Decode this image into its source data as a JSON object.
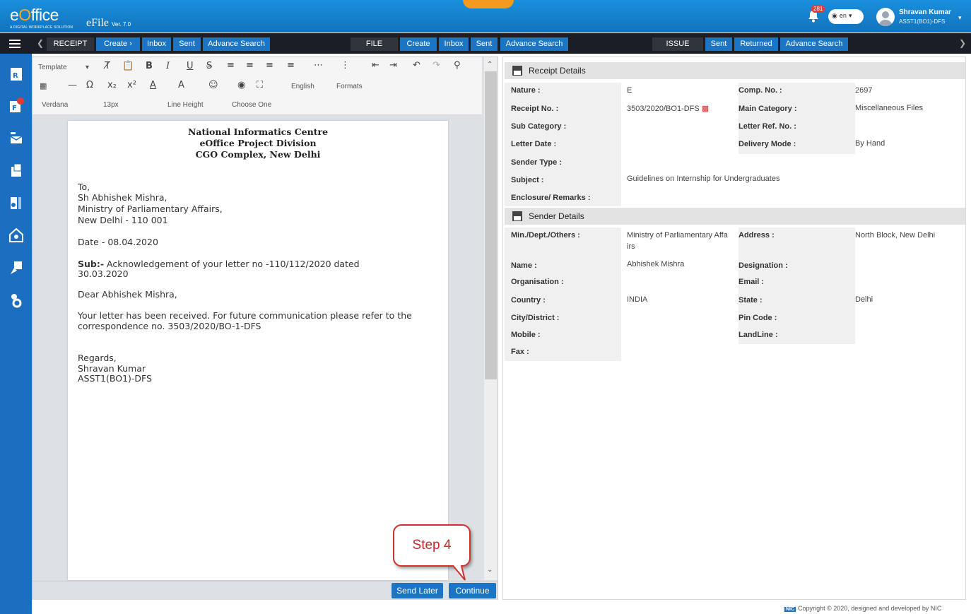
{
  "header": {
    "logo_e": "e",
    "logo_o": "O",
    "logo_rest": "ffice",
    "logo_tagline": "A DIGITAL WORKPLACE SOLUTION",
    "app_name": "eFile",
    "version": "Ver. 7.0",
    "notif_count": "281",
    "lang": "en",
    "user_name": "Shravan Kumar",
    "user_role": "ASST1(BO1)-DFS"
  },
  "nav": {
    "receipt": {
      "label": "RECEIPT",
      "create": "Create",
      "inbox": "Inbox",
      "sent": "Sent",
      "advance_search": "Advance Search"
    },
    "file": {
      "label": "FILE",
      "create": "Create",
      "inbox": "Inbox",
      "sent": "Sent",
      "advance_search": "Advance Search"
    },
    "issue": {
      "label": "ISSUE",
      "sent": "Sent",
      "returned": "Returned",
      "advance_search": "Advance Search"
    }
  },
  "toolbar": {
    "template": "Template",
    "language": "English",
    "formats": "Formats",
    "font": "Verdana",
    "size": "13px",
    "line_height": "Line Height",
    "choose_one": "Choose One"
  },
  "document": {
    "org1": "National Informatics Centre",
    "org2": "eOffice Project Division",
    "org3": "CGO Complex, New Delhi",
    "to": "To,",
    "addr1": "Sh Abhishek Mishra,",
    "addr2": "Ministry of Parliamentary Affairs,",
    "addr3": "New Delhi - 110 001",
    "date": "Date - 08.04.2020",
    "sub_label": "Sub:-",
    "sub_text": " Acknowledgement of your letter no -110/112/2020 dated",
    "sub_text2": "30.03.2020",
    "salutation": "Dear Abhishek Mishra,",
    "body1": "Your letter has been received. For future communication please refer to the",
    "body2": "correspondence no. 3503/2020/BO-1-DFS",
    "regards": "Regards,",
    "sign_name": "Shravan Kumar",
    "sign_role": "ASST1(BO1)-DFS"
  },
  "buttons": {
    "send_later": "Send Later",
    "continue": "Continue"
  },
  "callout": "Step 4",
  "receipt_details": {
    "title": "Receipt Details",
    "nature_label": "Nature :",
    "nature_value": "E",
    "comp_no_label": "Comp. No. :",
    "comp_no_value": "2697",
    "receipt_no_label": "Receipt No. :",
    "receipt_no_value": "3503/2020/BO1-DFS",
    "main_category_label": "Main Category :",
    "main_category_value": "Miscellaneous Files",
    "sub_category_label": "Sub Category :",
    "letter_ref_label": "Letter Ref. No. :",
    "letter_date_label": "Letter Date :",
    "delivery_mode_label": "Delivery Mode :",
    "delivery_mode_value": "By Hand",
    "sender_type_label": "Sender Type :",
    "subject_label": "Subject :",
    "subject_value": "Guidelines on Internship for Undergraduates",
    "enclosure_label": "Enclosure/ Remarks :"
  },
  "sender_details": {
    "title": "Sender Details",
    "ministry_label": "Min./Dept./Others :",
    "ministry_value1": "Ministry of Parliamentary Affa",
    "ministry_value2": "irs",
    "address_label": "Address :",
    "address_value": "North Block, New Delhi",
    "name_label": "Name :",
    "name_value": "Abhishek Mishra",
    "designation_label": "Designation :",
    "organisation_label": "Organisation :",
    "email_label": "Email :",
    "country_label": "Country :",
    "country_value": "INDIA",
    "state_label": "State :",
    "state_value": "Delhi",
    "city_label": "City/District :",
    "pin_label": "Pin Code :",
    "mobile_label": "Mobile :",
    "landline_label": "LandLine :",
    "fax_label": "Fax :"
  },
  "footer": {
    "nic": "NIC",
    "text": "Copyright © 2020, designed and developed by NIC"
  },
  "colors": {
    "primary": "#1c74c4",
    "header": "#1a8fdc",
    "navbar": "#1b1e24",
    "accent": "#f49a1e",
    "callout": "#d32f2f"
  }
}
